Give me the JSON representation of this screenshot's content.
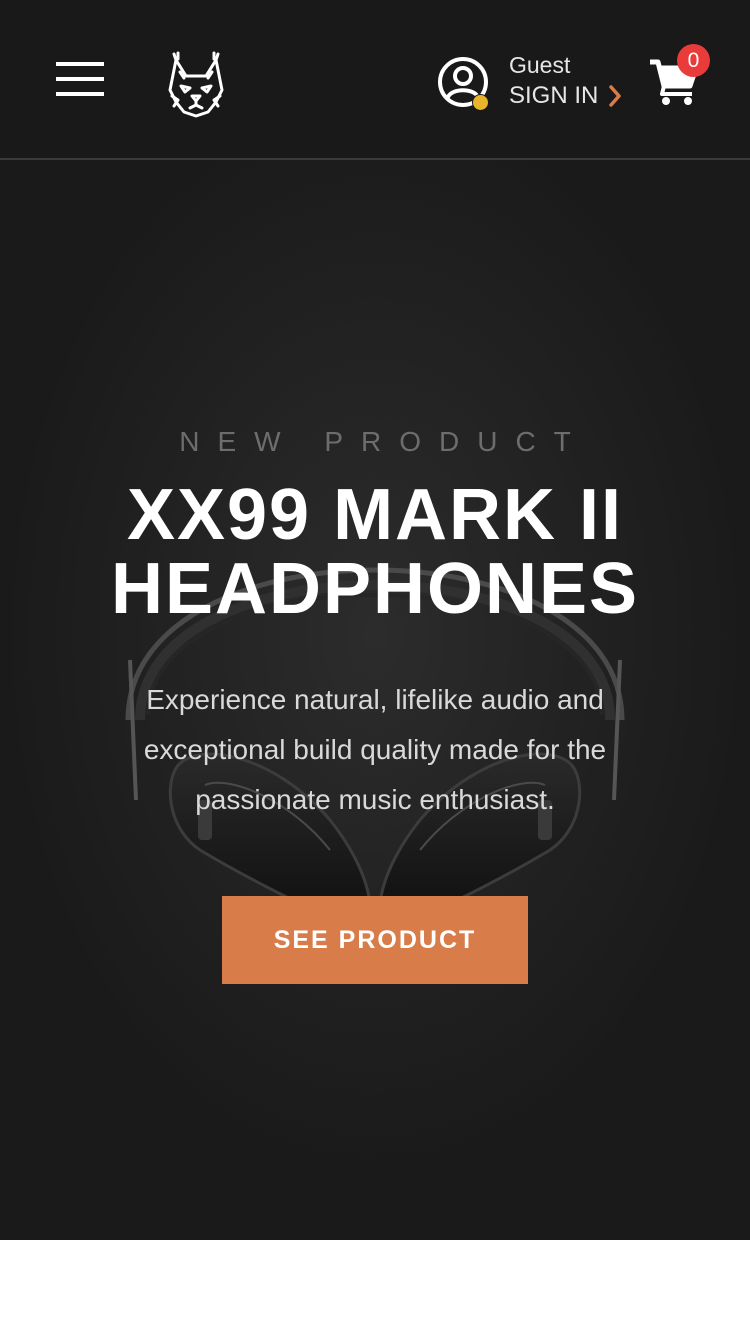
{
  "header": {
    "menu_icon": "hamburger-menu-icon",
    "logo_icon": "lynx-head-logo",
    "account": {
      "icon": "user-circle-icon",
      "status_color": "#e8b42a",
      "guest_label": "Guest",
      "signin_label": "SIGN IN",
      "chevron_icon": "chevron-right-icon",
      "chevron_color": "#d87d4a"
    },
    "cart": {
      "icon": "shopping-cart-icon",
      "count": "0",
      "badge_color": "#ea3b3b"
    }
  },
  "hero": {
    "eyebrow": "NEW PRODUCT",
    "title_line1": "XX99 MARK II",
    "title_line2": "HEADPHONES",
    "description": "Experience natural, lifelike audio and exceptional build quality made for the passionate music enthusiast.",
    "cta_label": "SEE PRODUCT",
    "cta_color": "#d87d4a",
    "background_image": "headphones-photo"
  },
  "colors": {
    "header_bg": "#191919",
    "hero_bg": "#1a1a1a",
    "accent": "#d87d4a"
  }
}
